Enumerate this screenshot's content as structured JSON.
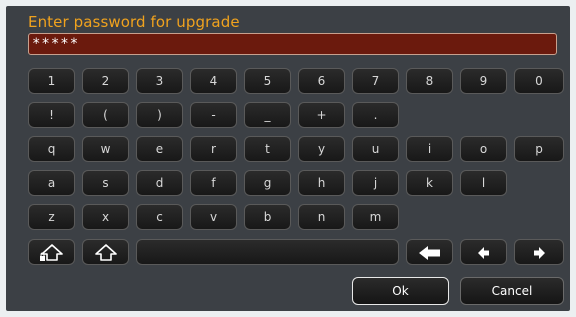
{
  "dialog": {
    "title": "Enter password for upgrade",
    "password_value": "*****"
  },
  "keyboard": {
    "row1": [
      "1",
      "2",
      "3",
      "4",
      "5",
      "6",
      "7",
      "8",
      "9",
      "0"
    ],
    "row2": [
      "!",
      "(",
      ")",
      "-",
      "_",
      "+",
      "."
    ],
    "row3": [
      "q",
      "w",
      "e",
      "r",
      "t",
      "y",
      "u",
      "i",
      "o",
      "p"
    ],
    "row4": [
      "a",
      "s",
      "d",
      "f",
      "g",
      "h",
      "j",
      "k",
      "l"
    ],
    "row5": [
      "z",
      "x",
      "c",
      "v",
      "b",
      "n",
      "m"
    ],
    "space_label": "",
    "icons": {
      "caps_lock": "caps-lock-icon",
      "shift": "shift-icon",
      "backspace": "backspace-icon",
      "left": "arrow-left-icon",
      "right": "arrow-right-icon"
    }
  },
  "actions": {
    "ok_label": "Ok",
    "cancel_label": "Cancel"
  },
  "colors": {
    "title": "#f0a21e",
    "field_bg": "#6b1a0d",
    "panel_bg": "#3c4045"
  }
}
